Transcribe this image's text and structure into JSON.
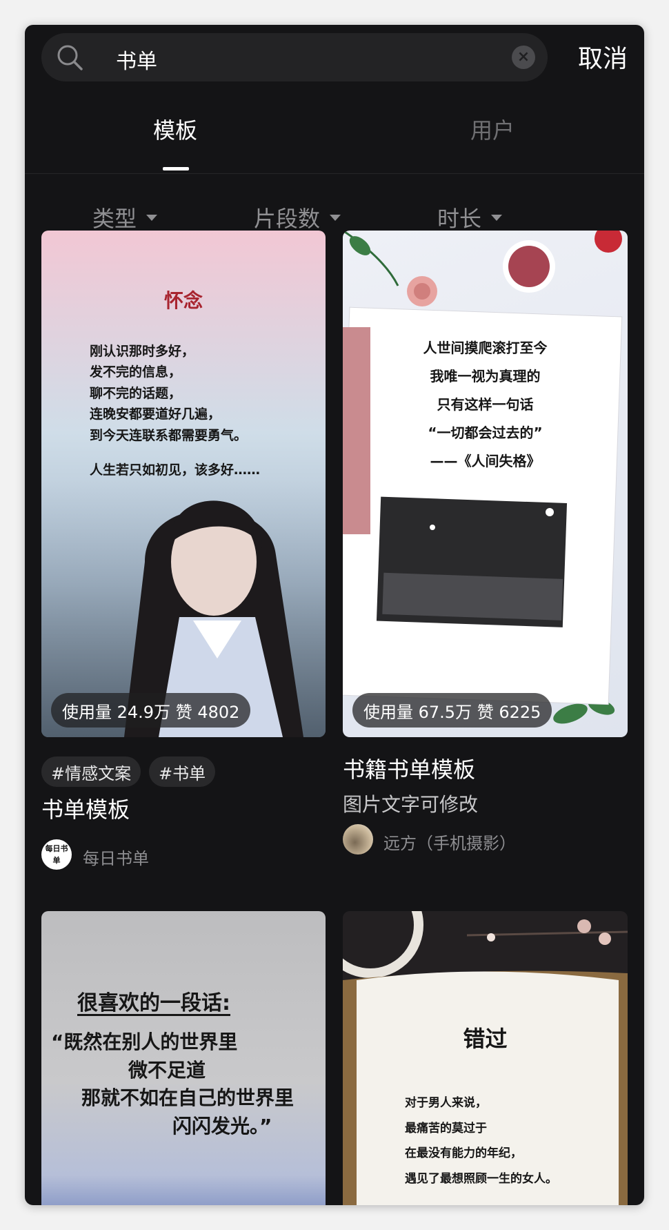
{
  "search": {
    "query": "书单",
    "cancel_label": "取消"
  },
  "tabs": [
    {
      "label": "模板",
      "active": true
    },
    {
      "label": "用户",
      "active": false
    }
  ],
  "filters": [
    {
      "label": "类型"
    },
    {
      "label": "片段数"
    },
    {
      "label": "时长"
    }
  ],
  "cards": [
    {
      "heading": "怀念",
      "poem_lines": [
        "刚认识那时多好，",
        "发不完的信息，",
        "聊不完的话题，",
        "连晚安都要道好几遍，",
        "到今天连联系都需要勇气。",
        "人生若只如初见，该多好……"
      ],
      "usage": "使用量 24.9万 赞 4802",
      "hashtags": [
        "#情感文案",
        "#书单"
      ],
      "title": "书单模板",
      "author": "每日书单",
      "avatar_text": "每日书单"
    },
    {
      "poem_lines": [
        "人世间摸爬滚打至今",
        "我唯一视为真理的",
        "只有这样一句话",
        "“一切都会过去的”",
        "——《人间失格》"
      ],
      "usage": "使用量 67.5万 赞 6225",
      "title": "书籍书单模板",
      "subtitle": "图片文字可修改",
      "author": "远方（手机摄影）"
    },
    {
      "heading": "很喜欢的一段话:",
      "poem_lines": [
        "“既然在别人的世界里",
        "微不足道",
        "那就不如在自己的世界里",
        "闪闪发光。”"
      ]
    },
    {
      "heading": "错过",
      "poem_lines": [
        "对于男人来说，",
        "最痛苦的莫过于",
        "在最没有能力的年纪，",
        "遇见了最想照顾一生的女人。"
      ]
    }
  ],
  "colors": {
    "background": "#141416",
    "accent_white": "#ffffff",
    "muted": "#6f6f72"
  }
}
